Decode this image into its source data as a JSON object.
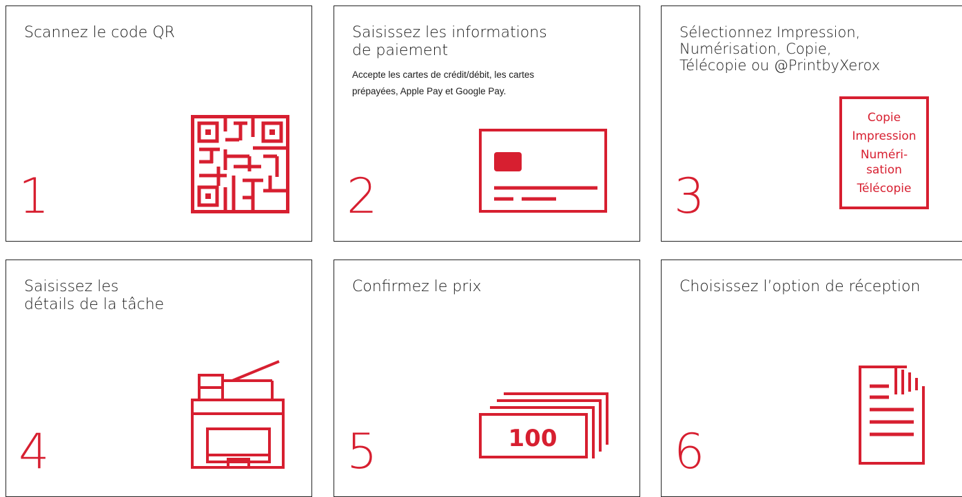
{
  "accent_color": "#d71f30",
  "steps": [
    {
      "number": "1",
      "title_lines": [
        "Scannez le code QR"
      ],
      "icon": "qr-code-icon"
    },
    {
      "number": "2",
      "title_lines": [
        "Saisissez les informations",
        "de paiement"
      ],
      "subtitle_lines": [
        "Accepte les cartes de crédit/débit, les cartes",
        "prépayées, Apple Pay et Google Pay."
      ],
      "icon": "credit-card-icon"
    },
    {
      "number": "3",
      "title_lines": [
        "Sélectionnez Impression,",
        "Numérisation, Copie,",
        "Télécopie ou @PrintbyXerox"
      ],
      "icon": "service-menu-icon",
      "menu_items": [
        "Copie",
        "Impression",
        "Numéri-",
        "sation",
        "Télécopie"
      ]
    },
    {
      "number": "4",
      "title_lines": [
        "Saisissez les",
        "détails de la tâche"
      ],
      "icon": "printer-icon"
    },
    {
      "number": "5",
      "title_lines": [
        "Confirmez le prix"
      ],
      "icon": "banknotes-icon",
      "note_value": "100"
    },
    {
      "number": "6",
      "title_lines": [
        "Choisissez l’option de réception"
      ],
      "icon": "document-icon"
    }
  ]
}
